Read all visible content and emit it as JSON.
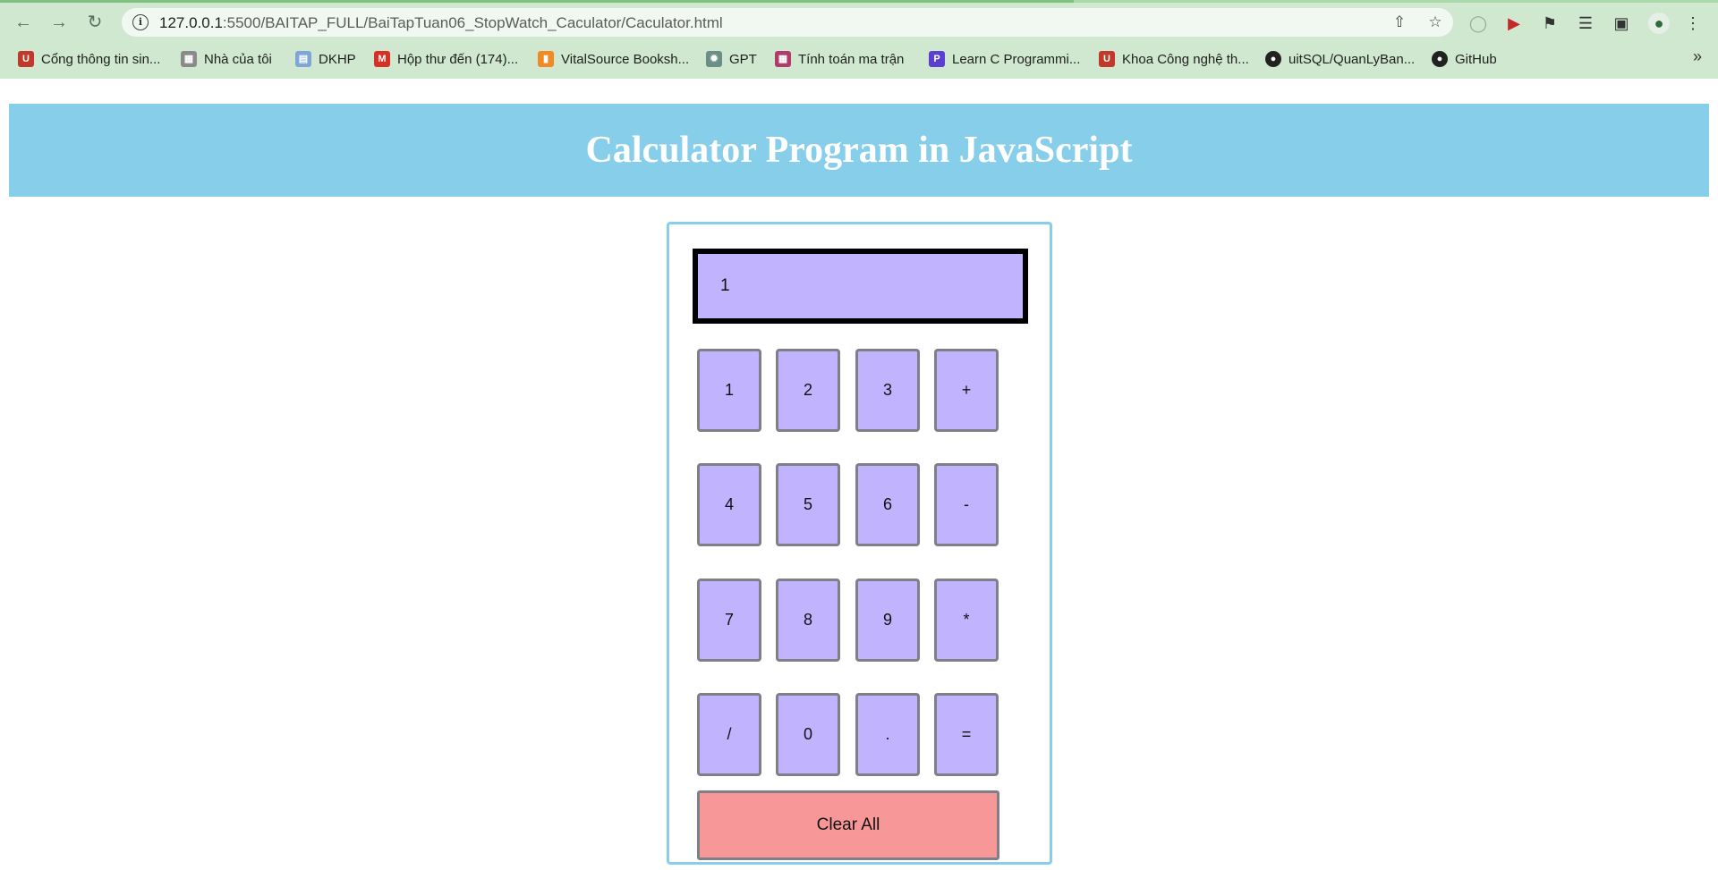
{
  "browser": {
    "url_host": "127.0.0.1",
    "url_rest": ":5500/BAITAP_FULL/BaiTapTuan06_StopWatch_Caculator/Caculator.html",
    "bookmarks": [
      {
        "label": "Cổng thông tin sin...",
        "icon": "uit-icon",
        "color": "#c0392b"
      },
      {
        "label": "Nhà của tôi",
        "icon": "page-icon",
        "color": "#8a8a8a"
      },
      {
        "label": "DKHP",
        "icon": "doc-icon",
        "color": "#7fa6d6"
      },
      {
        "label": "Hộp thư đến (174)...",
        "icon": "gmail-icon",
        "color": "#d93025"
      },
      {
        "label": "VitalSource Booksh...",
        "icon": "vitalsource-icon",
        "color": "#f08a24"
      },
      {
        "label": "GPT",
        "icon": "openai-icon",
        "color": "#6b8f85"
      },
      {
        "label": "Tính toán ma trận",
        "icon": "matrix-icon",
        "color": "#b03a6a"
      },
      {
        "label": "Learn C Programmi...",
        "icon": "programiz-icon",
        "color": "#5b3fd1"
      },
      {
        "label": "Khoa Công nghệ th...",
        "icon": "uit-icon",
        "color": "#c0392b"
      },
      {
        "label": "uitSQL/QuanLyBan...",
        "icon": "github-icon",
        "color": "#222222"
      },
      {
        "label": "GitHub",
        "icon": "github-icon",
        "color": "#222222"
      }
    ]
  },
  "page": {
    "title": "Calculator Program in JavaScript"
  },
  "calculator": {
    "display_value": "1",
    "keys": [
      "1",
      "2",
      "3",
      "+",
      "4",
      "5",
      "6",
      "-",
      "7",
      "8",
      "9",
      "*",
      "/",
      "0",
      ".",
      "="
    ],
    "clear_label": "Clear All"
  },
  "colors": {
    "banner": "#87ceeb",
    "key_fill": "#c2b3ff",
    "clear_fill": "#f79797"
  }
}
